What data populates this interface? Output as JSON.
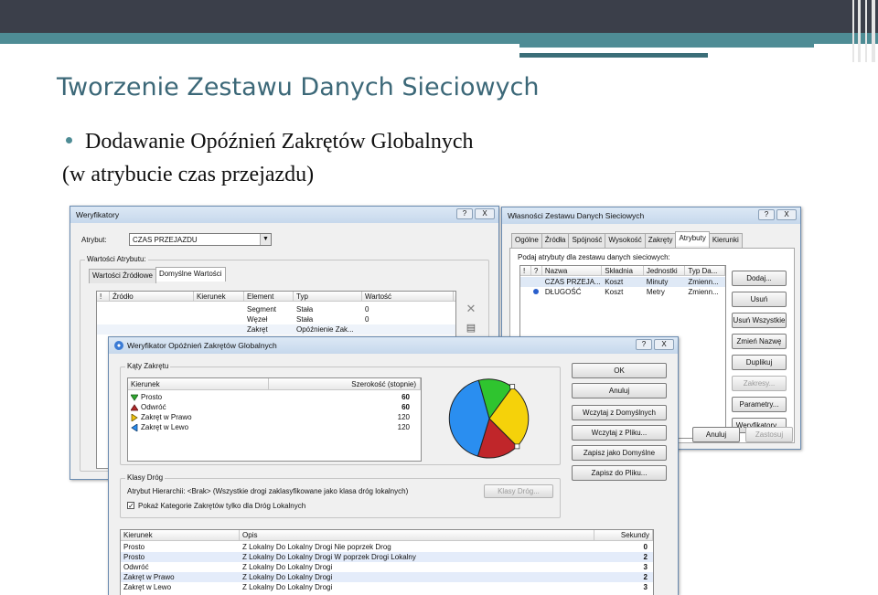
{
  "slide": {
    "title": "Tworzenie Zestawu Danych Sieciowych",
    "bullet": "Dodawanie Opóźnień Zakrętów Globalnych",
    "subline": "(w atrybucie czas przejazdu)"
  },
  "weryfikatory": {
    "title": "Weryfikatory",
    "help": "?",
    "close": "X",
    "atrybut_label": "Atrybut:",
    "atrybut_value": "CZAS PRZEJAZDU",
    "group_label": "Wartości Atrybutu:",
    "tabs": [
      "Wartości Źródłowe",
      "Domyślne Wartości"
    ],
    "columns": [
      "!",
      "Źródło",
      "Kierunek",
      "Element",
      "Typ",
      "Wartość"
    ],
    "rows": [
      {
        "element": "Segment",
        "typ": "Stała",
        "wartosc": "0"
      },
      {
        "element": "Węzeł",
        "typ": "Stała",
        "wartosc": "0"
      },
      {
        "element": "Zakręt",
        "typ": "Opóźnienie Zak...",
        "wartosc": ""
      }
    ]
  },
  "wlasnosci": {
    "title": "Własności Zestawu Danych Sieciowych",
    "help": "?",
    "close": "X",
    "tabs": [
      "Ogólne",
      "Źródła",
      "Spójność",
      "Wysokość",
      "Zakręty",
      "Atrybuty",
      "Kierunki"
    ],
    "active_tab": "Atrybuty",
    "prompt": "Podaj atrybuty dla zestawu danych sieciowych:",
    "columns": [
      "!",
      "?",
      "Nazwa",
      "Składnia",
      "Jednostki",
      "Typ Da..."
    ],
    "rows": [
      {
        "nazwa": "CZAS PRZEJA...",
        "skladnia": "Koszt",
        "jednostki": "Minuty",
        "typ": "Zmienn..."
      },
      {
        "nazwa": "DŁUGOŚĆ",
        "skladnia": "Koszt",
        "jednostki": "Metry",
        "typ": "Zmienn..."
      }
    ],
    "buttons": [
      "Dodaj...",
      "Usuń",
      "Usuń Wszystkie",
      "Zmień Nazwę",
      "Duplikuj",
      "Zakresy...",
      "Parametry...",
      "Weryfikatory..."
    ],
    "bottom_buttons": [
      "Anuluj",
      "Zastosuj"
    ]
  },
  "opoznien": {
    "title": "Weryfikator Opóźnień Zakrętów Globalnych",
    "help": "?",
    "close": "X",
    "katy_label": "Kąty Zakrętu",
    "katy_columns": [
      "Kierunek",
      "Szerokość (stopnie)"
    ],
    "katy_rows": [
      {
        "name": "Prosto",
        "value": "60",
        "bold": true,
        "color": "#2fa82f"
      },
      {
        "name": "Odwróć",
        "value": "60",
        "bold": true,
        "color": "#b02a2a"
      },
      {
        "name": "Zakręt w Prawo",
        "value": "120",
        "bold": false,
        "color": "#f2c40f"
      },
      {
        "name": "Zakręt w Lewo",
        "value": "120",
        "bold": false,
        "color": "#2a8ef0"
      }
    ],
    "pie_colors": {
      "green": "#2fc42f",
      "yellow": "#f5d20a",
      "red": "#c0262a",
      "blue": "#2a8ef0"
    },
    "klasy_label": "Klasy Dróg",
    "atrybut_hierarchii": "Atrybut Hierarchii: <Brak> (Wszystkie drogi zaklasyfikowane jako klasa dróg lokalnych)",
    "klasy_button": "Klasy Dróg...",
    "checkbox_label": "Pokaż Kategorie Zakrętów tylko dla Dróg Lokalnych",
    "buttons": [
      "OK",
      "Anuluj",
      "Wczytaj z Domyślnych",
      "Wczytaj z Pliku...",
      "Zapisz jako Domyślne",
      "Zapisz do Pliku..."
    ],
    "table_columns": [
      "Kierunek",
      "Opis",
      "Sekundy"
    ],
    "table_rows": [
      {
        "kierunek": "Prosto",
        "opis": "Z Lokalny Do Lokalny Drogi Nie poprzek Drog",
        "sekundy": "0"
      },
      {
        "kierunek": "Prosto",
        "opis": "Z Lokalny Do Lokalny Drogi W poprzek Drogi Lokalny",
        "sekundy": "2"
      },
      {
        "kierunek": "Odwróć",
        "opis": "Z Lokalny Do Lokalny Drogi",
        "sekundy": "3"
      },
      {
        "kierunek": "Zakręt w Prawo",
        "opis": "Z Lokalny Do Lokalny Drogi",
        "sekundy": "2"
      },
      {
        "kierunek": "Zakręt w Lewo",
        "opis": "Z Lokalny Do Lokalny Drogi",
        "sekundy": "3"
      }
    ]
  }
}
